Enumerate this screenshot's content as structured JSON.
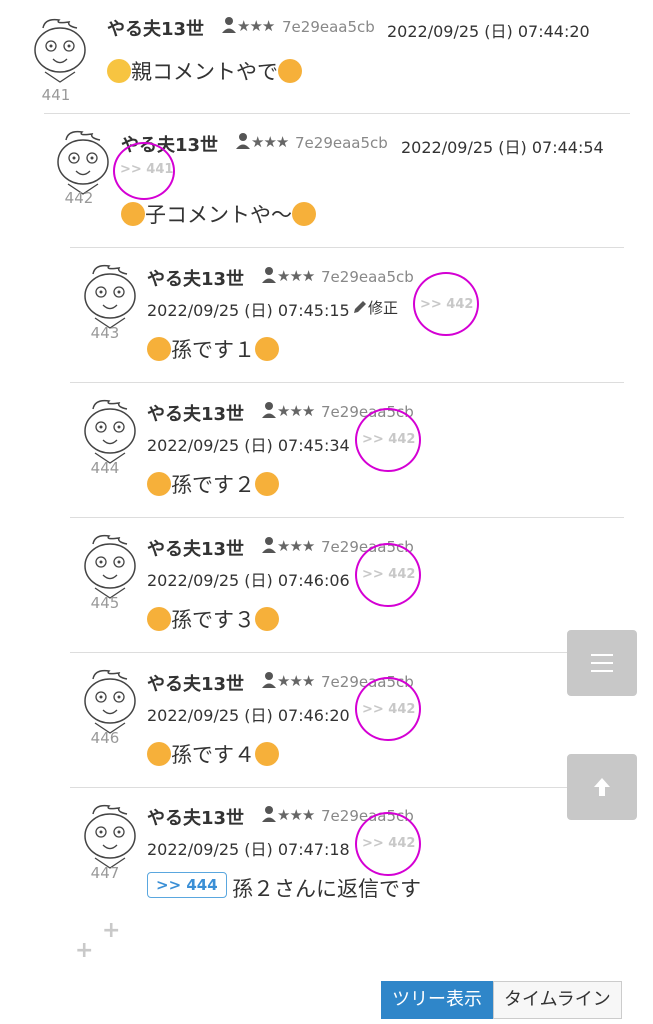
{
  "posts": [
    {
      "num": "441",
      "name": "やる夫13世",
      "rank": "★★★",
      "uid": "7e29eaa5cb",
      "date": "2022/09/25 (日) 07:44:20",
      "body": "親コメントやで"
    },
    {
      "num": "442",
      "name": "やる夫13世",
      "rank": "★★★",
      "uid": "7e29eaa5cb",
      "date": "2022/09/25 (日) 07:44:54",
      "anchor": ">> 441",
      "body": "子コメントや～"
    },
    {
      "num": "443",
      "name": "やる夫13世",
      "rank": "★★★",
      "uid": "7e29eaa5cb",
      "date": "2022/09/25 (日) 07:45:15",
      "edit": "修正",
      "anchor": ">> 442",
      "body": "孫です１"
    },
    {
      "num": "444",
      "name": "やる夫13世",
      "rank": "★★★",
      "uid": "7e29eaa5cb",
      "date": "2022/09/25 (日) 07:45:34",
      "anchor": ">> 442",
      "body": "孫です２"
    },
    {
      "num": "445",
      "name": "やる夫13世",
      "rank": "★★★",
      "uid": "7e29eaa5cb",
      "date": "2022/09/25 (日) 07:46:06",
      "anchor": ">> 442",
      "body": "孫です３"
    },
    {
      "num": "446",
      "name": "やる夫13世",
      "rank": "★★★",
      "uid": "7e29eaa5cb",
      "date": "2022/09/25 (日) 07:46:20",
      "anchor": ">> 442",
      "body": "孫です４"
    },
    {
      "num": "447",
      "name": "やる夫13世",
      "rank": "★★★",
      "uid": "7e29eaa5cb",
      "date": "2022/09/25 (日) 07:47:18",
      "anchor": ">> 442",
      "reply": ">> 444",
      "body": "孫２さんに返信です"
    }
  ],
  "tabs": {
    "tree": "ツリー表示",
    "timeline": "タイムライン"
  },
  "side": {
    "menu_icon": "menu-icon",
    "up_icon": "arrow-up-icon"
  },
  "colors": {
    "accent": "#2f86c9",
    "highlight": "#d400d4"
  }
}
